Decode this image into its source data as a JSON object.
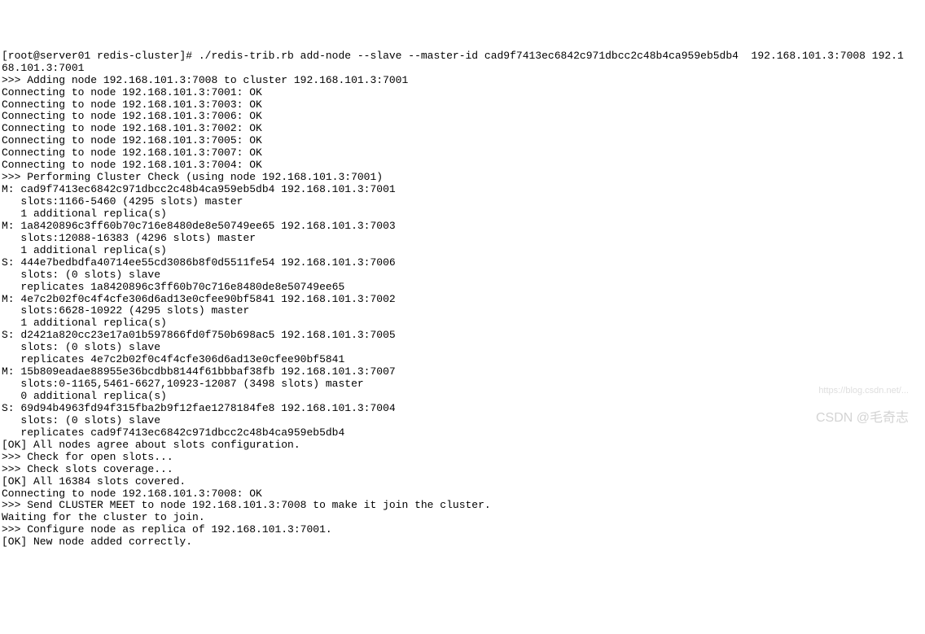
{
  "terminal": {
    "lines": [
      "[root@server01 redis-cluster]# ./redis-trib.rb add-node --slave --master-id cad9f7413ec6842c971dbcc2c48b4ca959eb5db4  192.168.101.3:7008 192.1",
      "68.101.3:7001",
      ">>> Adding node 192.168.101.3:7008 to cluster 192.168.101.3:7001",
      "Connecting to node 192.168.101.3:7001: OK",
      "Connecting to node 192.168.101.3:7003: OK",
      "Connecting to node 192.168.101.3:7006: OK",
      "Connecting to node 192.168.101.3:7002: OK",
      "Connecting to node 192.168.101.3:7005: OK",
      "Connecting to node 192.168.101.3:7007: OK",
      "Connecting to node 192.168.101.3:7004: OK",
      ">>> Performing Cluster Check (using node 192.168.101.3:7001)",
      "M: cad9f7413ec6842c971dbcc2c48b4ca959eb5db4 192.168.101.3:7001",
      "   slots:1166-5460 (4295 slots) master",
      "   1 additional replica(s)",
      "M: 1a8420896c3ff60b70c716e8480de8e50749ee65 192.168.101.3:7003",
      "   slots:12088-16383 (4296 slots) master",
      "   1 additional replica(s)",
      "S: 444e7bedbdfa40714ee55cd3086b8f0d5511fe54 192.168.101.3:7006",
      "   slots: (0 slots) slave",
      "   replicates 1a8420896c3ff60b70c716e8480de8e50749ee65",
      "M: 4e7c2b02f0c4f4cfe306d6ad13e0cfee90bf5841 192.168.101.3:7002",
      "   slots:6628-10922 (4295 slots) master",
      "   1 additional replica(s)",
      "S: d2421a820cc23e17a01b597866fd0f750b698ac5 192.168.101.3:7005",
      "   slots: (0 slots) slave",
      "   replicates 4e7c2b02f0c4f4cfe306d6ad13e0cfee90bf5841",
      "M: 15b809eadae88955e36bcdbb8144f61bbbaf38fb 192.168.101.3:7007",
      "   slots:0-1165,5461-6627,10923-12087 (3498 slots) master",
      "   0 additional replica(s)",
      "S: 69d94b4963fd94f315fba2b9f12fae1278184fe8 192.168.101.3:7004",
      "   slots: (0 slots) slave",
      "   replicates cad9f7413ec6842c971dbcc2c48b4ca959eb5db4",
      "[OK] All nodes agree about slots configuration.",
      ">>> Check for open slots...",
      ">>> Check slots coverage...",
      "[OK] All 16384 slots covered.",
      "Connecting to node 192.168.101.3:7008: OK",
      ">>> Send CLUSTER MEET to node 192.168.101.3:7008 to make it join the cluster.",
      "Waiting for the cluster to join.",
      ">>> Configure node as replica of 192.168.101.3:7001.",
      "[OK] New node added correctly."
    ]
  },
  "watermark": {
    "main": "CSDN @毛奇志",
    "sub": "https://blog.csdn.net/..."
  }
}
